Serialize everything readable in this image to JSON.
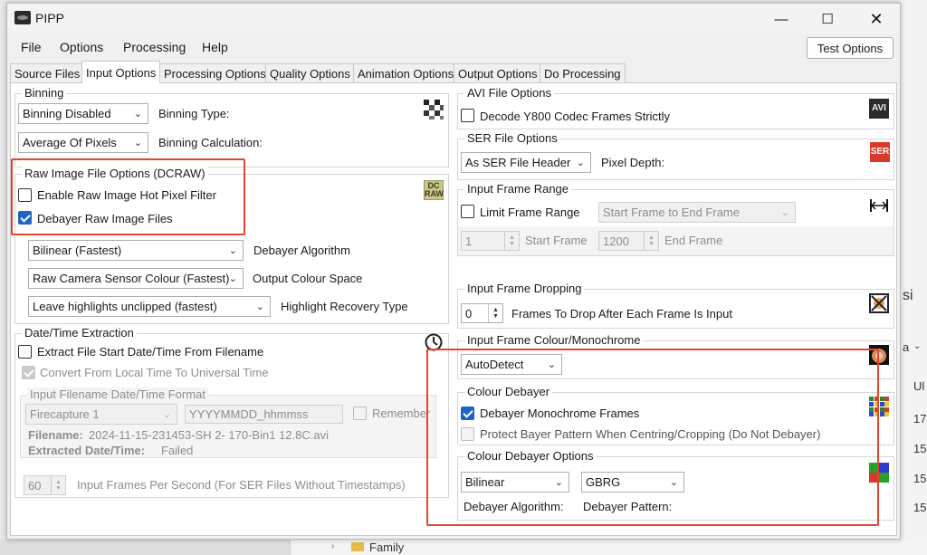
{
  "window": {
    "title": "PIPP"
  },
  "menu": [
    "File",
    "Options",
    "Processing",
    "Help"
  ],
  "test_options_label": "Test Options",
  "tabs": [
    "Source Files",
    "Input Options",
    "Processing Options",
    "Quality Options",
    "Animation Options",
    "Output Options",
    "Do Processing"
  ],
  "binning": {
    "title": "Binning",
    "type_value": "Binning Disabled",
    "type_label": "Binning Type:",
    "calc_value": "Average Of Pixels",
    "calc_label": "Binning Calculation:"
  },
  "raw": {
    "title": "Raw Image File Options (DCRAW)",
    "hot_pixel_label": "Enable Raw Image Hot Pixel Filter",
    "hot_pixel_checked": false,
    "debayer_label": "Debayer Raw Image Files",
    "debayer_checked": true,
    "algorithm_value": "Bilinear (Fastest)",
    "algorithm_label": "Debayer Algorithm",
    "colour_space_value": "Raw Camera Sensor Colour (Fastest)",
    "colour_space_label": "Output Colour Space",
    "highlight_value": "Leave highlights unclipped (fastest)",
    "highlight_label": "Highlight Recovery Type",
    "icon_text": "DC RAW"
  },
  "datetime": {
    "title": "Date/Time Extraction",
    "extract_label": "Extract File Start Date/Time From Filename",
    "convert_label": "Convert From Local Time To Universal Time",
    "format_title": "Input Filename Date/Time Format",
    "format_value": "Firecapture 1",
    "format_pattern": "YYYYMMDD_hhmmss",
    "remember_label": "Remember",
    "filename_label": "Filename:",
    "filename_value": "2024-11-15-231453-SH 2- 170-Bin1 12.8C.avi",
    "extracted_label": "Extracted Date/Time:",
    "extracted_value": "Failed",
    "fps_value": "60",
    "fps_label": "Input Frames Per Second (For SER Files Without Timestamps)"
  },
  "avi": {
    "title": "AVI File Options",
    "decode_label": "Decode Y800 Codec Frames Strictly",
    "icon_text": "AVI"
  },
  "ser": {
    "title": "SER File Options",
    "depth_value": "As SER File Header",
    "depth_label": "Pixel Depth:",
    "icon_text": "SER"
  },
  "frame_range": {
    "title": "Input Frame Range",
    "limit_label": "Limit Frame Range",
    "mode_value": "Start Frame to End Frame",
    "start_value": "1",
    "start_label": "Start Frame",
    "end_value": "1200",
    "end_label": "End Frame"
  },
  "frame_dropping": {
    "title": "Input Frame Dropping",
    "value": "0",
    "label": "Frames To Drop After Each Frame Is Input"
  },
  "colour_mono": {
    "title": "Input Frame Colour/Monochrome",
    "value": "AutoDetect"
  },
  "colour_debayer": {
    "title": "Colour Debayer",
    "mono_label": "Debayer Monochrome Frames",
    "mono_checked": true,
    "protect_label": "Protect Bayer Pattern When Centring/Cropping (Do Not Debayer)"
  },
  "debayer_options": {
    "title": "Colour Debayer Options",
    "algorithm_value": "Bilinear",
    "algorithm_label": "Debayer Algorithm:",
    "pattern_value": "GBRG",
    "pattern_label": "Debayer Pattern:"
  },
  "background": {
    "text_a": "si",
    "text_b": "a",
    "text_c": "Ul",
    "text_d": "17",
    "text_e": "15",
    "text_f": "15",
    "text_g": "15",
    "folder_label": "Family"
  },
  "colors": {
    "highlight": "#e0452e",
    "check": "#1d63c8",
    "accent": "#0078d4"
  }
}
